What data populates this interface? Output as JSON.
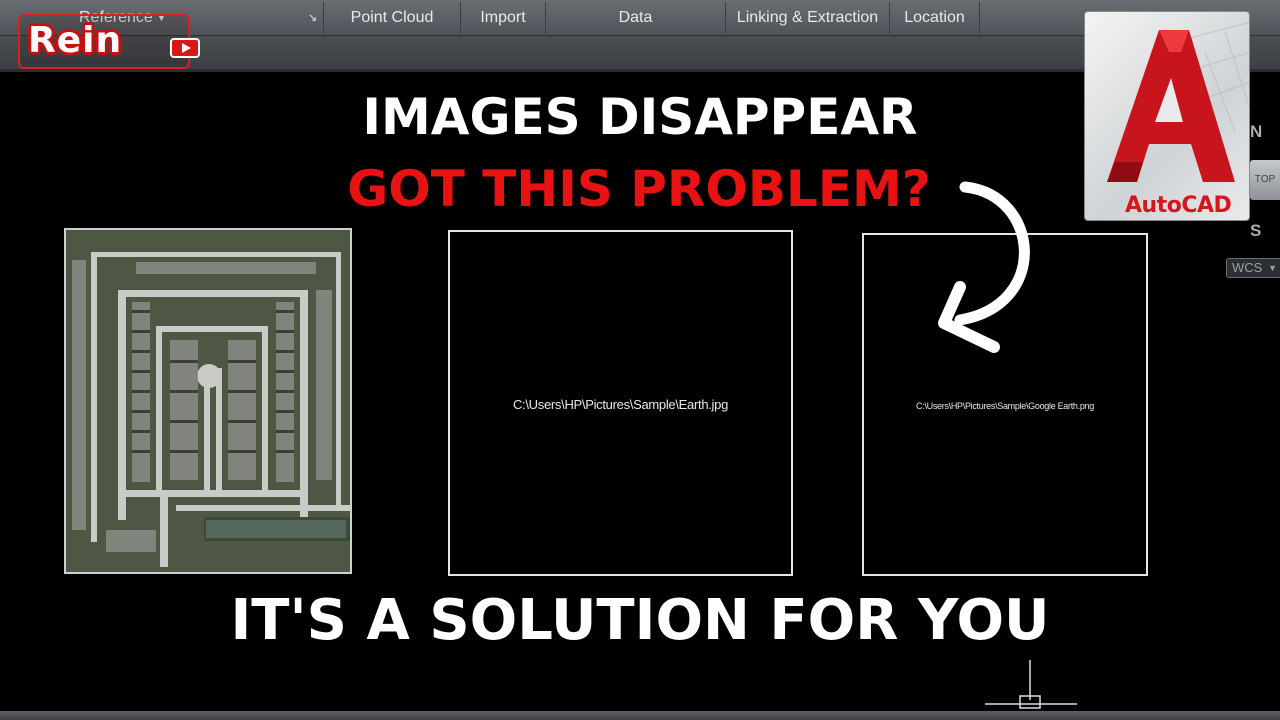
{
  "ribbon": {
    "tabs": [
      {
        "label": "Reference"
      },
      {
        "label": "Point Cloud"
      },
      {
        "label": "Import"
      },
      {
        "label": "Data"
      },
      {
        "label": "Linking & Extraction"
      },
      {
        "label": "Location"
      }
    ]
  },
  "channel_logo": {
    "text": "Rein"
  },
  "headline": {
    "line1": "IMAGES DISAPPEAR",
    "line2": "GOT THIS PROBLEM?",
    "line3": "IT'S A SOLUTION FOR YOU",
    "line2_color": "#e81212"
  },
  "frames": [
    {
      "path": "C:\\Users\\HP\\Pictures\\Sample\\Earth.jpg"
    },
    {
      "path": "C:\\Users\\HP\\Pictures\\Sample\\Google Earth.png"
    }
  ],
  "autocad_logo": {
    "text": "AutoCAD"
  },
  "viewcube": {
    "north": "N",
    "south": "S",
    "top": "TOP",
    "wcs": "WCS"
  },
  "icons": [
    "dropdown-caret-icon",
    "panel-launcher-icon",
    "play-icon",
    "curved-arrow-icon",
    "autocad-a-icon",
    "ucs-crosshair-icon"
  ]
}
